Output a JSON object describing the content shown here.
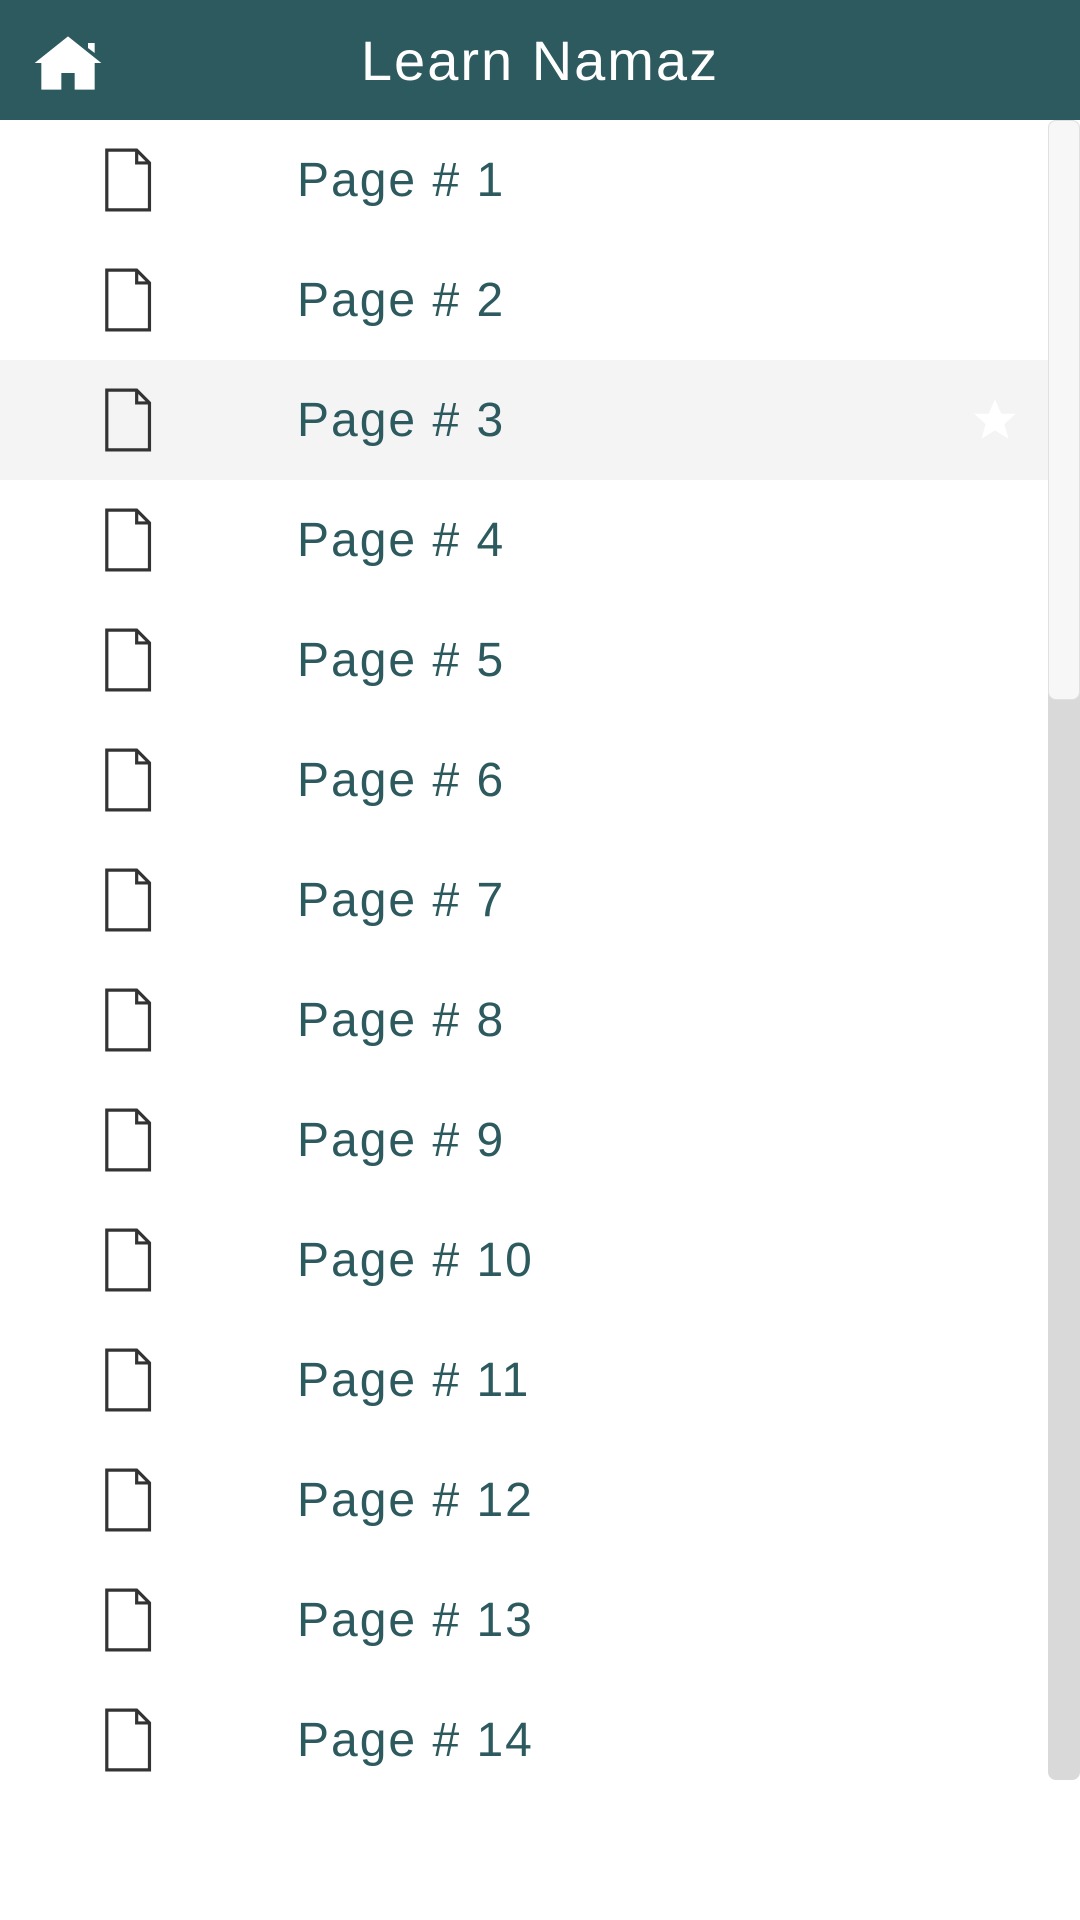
{
  "header": {
    "title": "Learn Namaz"
  },
  "pages": [
    {
      "label": "Page # 1",
      "selected": false
    },
    {
      "label": "Page # 2",
      "selected": false
    },
    {
      "label": "Page # 3",
      "selected": true
    },
    {
      "label": "Page # 4",
      "selected": false
    },
    {
      "label": "Page # 5",
      "selected": false
    },
    {
      "label": "Page # 6",
      "selected": false
    },
    {
      "label": "Page # 7",
      "selected": false
    },
    {
      "label": "Page # 8",
      "selected": false
    },
    {
      "label": "Page # 9",
      "selected": false
    },
    {
      "label": "Page # 10",
      "selected": false
    },
    {
      "label": "Page # 11",
      "selected": false
    },
    {
      "label": "Page # 12",
      "selected": false
    },
    {
      "label": "Page # 13",
      "selected": false
    },
    {
      "label": "Page # 14",
      "selected": false
    }
  ],
  "colors": {
    "headerBg": "#2d5a5f",
    "textColor": "#2d5a5f",
    "selectedBg": "#f4f4f4"
  }
}
